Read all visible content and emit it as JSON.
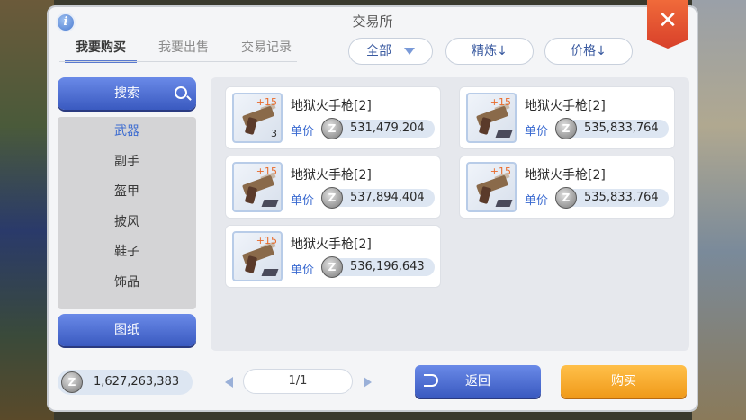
{
  "window": {
    "title": "交易所"
  },
  "tabs": [
    {
      "label": "我要购买",
      "active": true
    },
    {
      "label": "我要出售",
      "active": false
    },
    {
      "label": "交易记录",
      "active": false
    }
  ],
  "filters": {
    "category": "全部",
    "refine": "精炼↓",
    "price": "价格↓"
  },
  "sidebar": {
    "search_label": "搜索",
    "categories": [
      "武器",
      "副手",
      "盔甲",
      "披风",
      "鞋子",
      "饰品"
    ],
    "active_category": "武器",
    "blueprint_label": "图纸",
    "zeny_balance": "1,627,263,383"
  },
  "items": [
    {
      "name": "地狱火手枪[2]",
      "price_label": "单价",
      "price": "531,479,204",
      "refine": "+15",
      "count": "3"
    },
    {
      "name": "地狱火手枪[2]",
      "price_label": "单价",
      "price": "535,833,764",
      "refine": "+15"
    },
    {
      "name": "地狱火手枪[2]",
      "price_label": "单价",
      "price": "537,894,404",
      "refine": "+15"
    },
    {
      "name": "地狱火手枪[2]",
      "price_label": "单价",
      "price": "535,833,764",
      "refine": "+15"
    },
    {
      "name": "地狱火手枪[2]",
      "price_label": "单价",
      "price": "536,196,643",
      "refine": "+15"
    }
  ],
  "pagination": {
    "page": "1/1"
  },
  "actions": {
    "back_label": "返回",
    "buy_label": "购买"
  },
  "icons": {
    "zeny": "Z",
    "info": "i",
    "close": "✕"
  },
  "colors": {
    "accent": "#4a6ad0",
    "buy": "#f5a623",
    "close": "#e04a2a"
  }
}
